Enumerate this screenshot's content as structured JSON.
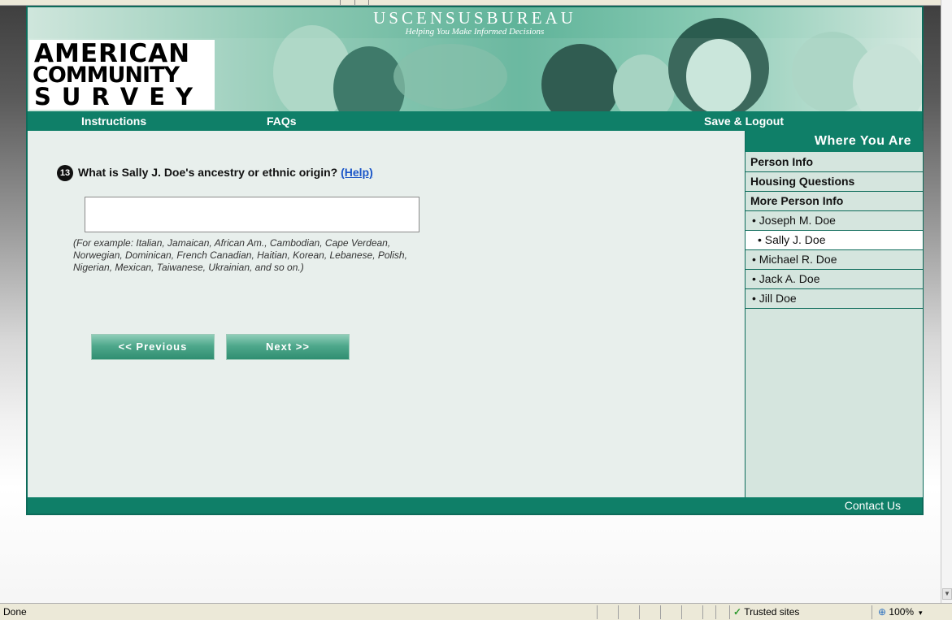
{
  "banner": {
    "bureau_name": "USCENSUSBUREAU",
    "bureau_tagline": "Helping You Make Informed Decisions",
    "logo_line1": "AMERICAN",
    "logo_line2": "COMMUNITY",
    "logo_line3": "SURVEY"
  },
  "nav": {
    "instructions": "Instructions",
    "faqs": "FAQs",
    "save_logout": "Save & Logout"
  },
  "question": {
    "number": "13",
    "text": "What is Sally J. Doe's ancestry or ethnic origin?",
    "help_label": "(Help)",
    "input_value": "",
    "example": "(For example: Italian, Jamaican, African Am., Cambodian, Cape Verdean, Norwegian, Dominican, French Canadian, Haitian, Korean, Lebanese, Polish, Nigerian, Mexican, Taiwanese, Ukrainian, and so on.)"
  },
  "buttons": {
    "previous": "<<   Previous",
    "next": "Next   >>"
  },
  "sidebar": {
    "title": "Where You Are",
    "sections": [
      "Person Info",
      "Housing Questions",
      "More Person Info"
    ],
    "persons": [
      "• Joseph M. Doe",
      "• Sally J. Doe",
      "• Michael R. Doe",
      "• Jack A. Doe",
      "• Jill Doe"
    ],
    "active_person": "• Sally J. Doe"
  },
  "footer": {
    "contact_us": "Contact Us"
  },
  "statusbar": {
    "status": "Done",
    "zone": "Trusted sites",
    "zoom": "100%"
  },
  "colors": {
    "brand_green": "#0f7f68",
    "sidebar_bg": "#d5e5de",
    "link_blue": "#1a55c8"
  }
}
